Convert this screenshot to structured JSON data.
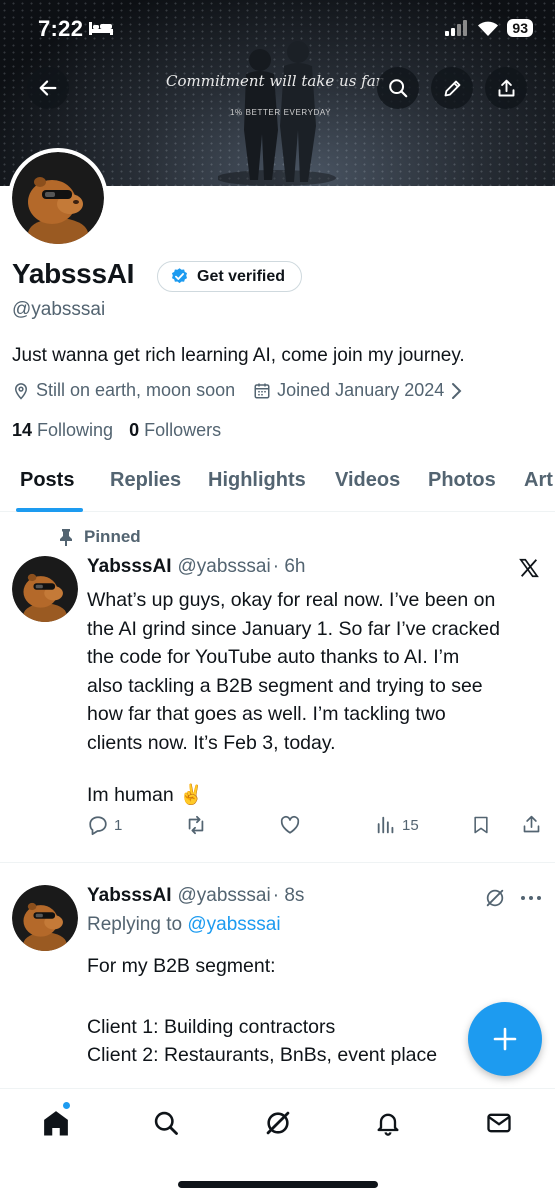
{
  "status_bar": {
    "time": "7:22",
    "battery": "93"
  },
  "banner": {
    "quote": "Commitment will take us far",
    "subtitle": "1% BETTER EVERYDAY"
  },
  "profile": {
    "display_name": "YabsssAI",
    "verify_label": "Get verified",
    "handle": "@yabsssai",
    "bio": "Just wanna get rich learning AI, come join my journey.",
    "location": "Still on earth, moon soon",
    "joined": "Joined January 2024",
    "following_count": "14",
    "following_label": "Following",
    "followers_count": "0",
    "followers_label": "Followers"
  },
  "tabs": [
    {
      "label": "Posts",
      "active": true
    },
    {
      "label": "Replies"
    },
    {
      "label": "Highlights"
    },
    {
      "label": "Videos"
    },
    {
      "label": "Photos"
    },
    {
      "label": "Art"
    }
  ],
  "posts": [
    {
      "pinned_label": "Pinned",
      "name": "YabsssAI",
      "handle": "@yabsssai",
      "time": "· 6h",
      "lines": [
        "What’s up guys, okay for real now. I’ve been on",
        "the AI grind since January 1. So far I’ve cracked",
        "the code for YouTube auto thanks to AI. I’m",
        "also tackling a B2B segment and trying to see",
        "how far that goes as well. I’m tackling two",
        "clients now. It’s Feb 3, today.",
        "",
        "Im human ✌️"
      ],
      "replies": "1",
      "views": "15"
    },
    {
      "name": "YabsssAI",
      "handle": "@yabsssai",
      "time": "· 8s",
      "replying_prefix": "Replying to ",
      "replying_handle": "@yabsssai",
      "lines": [
        "For my B2B segment:",
        "",
        "Client 1: Building contractors",
        "Client 2: Restaurants, BnBs, event place"
      ]
    }
  ],
  "colors": {
    "accent": "#1d9bf0",
    "text": "#0f1419",
    "muted": "#536471"
  },
  "icons": [
    "back-icon",
    "search-icon",
    "edit-icon",
    "share-icon",
    "verified-badge-icon",
    "location-icon",
    "calendar-icon",
    "chevron-right-icon",
    "pin-icon",
    "x-logo-icon",
    "reply-icon",
    "retweet-icon",
    "like-icon",
    "views-icon",
    "bookmark-icon",
    "grok-icon",
    "more-icon",
    "plus-icon",
    "home-icon",
    "notifications-icon",
    "messages-icon"
  ]
}
